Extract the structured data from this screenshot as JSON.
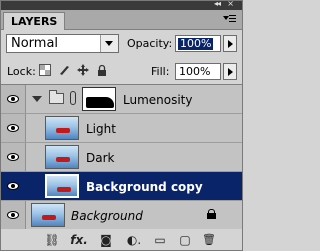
{
  "panel": {
    "tab": "LAYERS",
    "titlebar_chevrons": "◂◂",
    "titlebar_close": "×"
  },
  "blend": {
    "mode": "Normal",
    "opacity_label": "Opacity:",
    "opacity_value": "100%"
  },
  "lock": {
    "label": "Lock:",
    "fill_label": "Fill:",
    "fill_value": "100%"
  },
  "layers": [
    {
      "name": "Lumenosity",
      "type": "group",
      "visible": true,
      "expanded": true
    },
    {
      "name": "Light",
      "type": "layer",
      "visible": true,
      "indented": true
    },
    {
      "name": "Dark",
      "type": "layer",
      "visible": true,
      "indented": true
    },
    {
      "name": "Background copy",
      "type": "layer",
      "visible": true,
      "selected": true
    },
    {
      "name": "Background",
      "type": "background",
      "visible": true,
      "locked": true
    }
  ],
  "toolbar": {
    "link": "⛓",
    "fx": "fx.",
    "mask": "◙",
    "adjustment": "◐.",
    "new_group": "▭",
    "new_layer": "▢",
    "delete": "🗑"
  },
  "colors": {
    "selection": "#0a246a",
    "panel_bg": "#d4d4d4",
    "titlebar": "#3a3a3a"
  }
}
